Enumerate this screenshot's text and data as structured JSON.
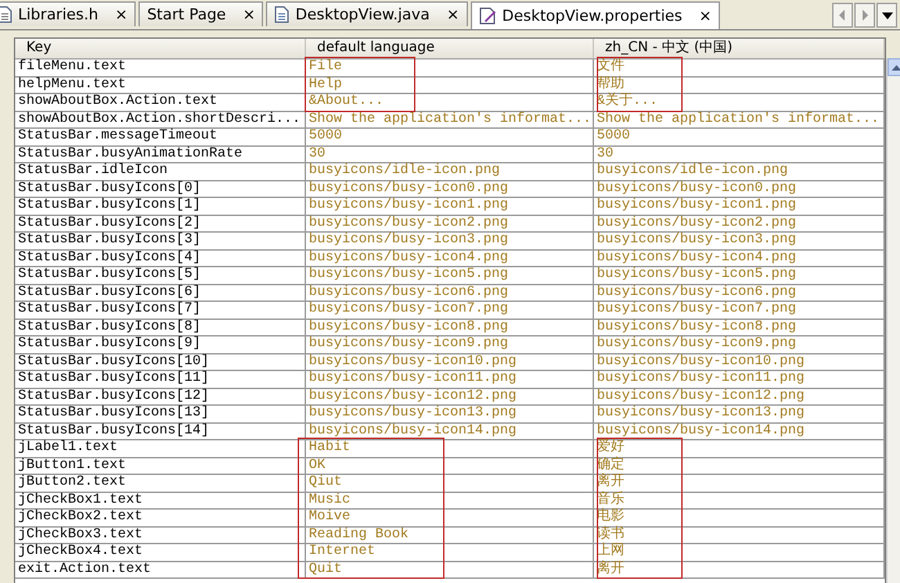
{
  "tabs": [
    {
      "label": "Libraries.h",
      "kind": "header",
      "close": "×",
      "selected": false
    },
    {
      "label": "Start Page",
      "kind": "none",
      "close": "×",
      "selected": false
    },
    {
      "label": "DesktopView.java",
      "kind": "java",
      "close": "×",
      "selected": false
    },
    {
      "label": "DesktopView.properties",
      "kind": "properties",
      "close": "×",
      "selected": true
    }
  ],
  "table": {
    "columns": [
      "Key",
      "default language",
      "zh_CN - 中文 (中国)"
    ],
    "rows": [
      {
        "key": "fileMenu.text",
        "default": "File",
        "zh": "文件",
        "marked": true
      },
      {
        "key": "helpMenu.text",
        "default": "Help",
        "zh": "帮助",
        "marked": true
      },
      {
        "key": "showAboutBox.Action.text",
        "default": "&About...",
        "zh": "&关于...",
        "marked": true
      },
      {
        "key": "showAboutBox.Action.shortDescri...",
        "default": "Show the application's informat...",
        "zh": "Show the application's informat...",
        "marked": false
      },
      {
        "key": "StatusBar.messageTimeout",
        "default": "5000",
        "zh": "5000",
        "marked": false
      },
      {
        "key": "StatusBar.busyAnimationRate",
        "default": "30",
        "zh": "30",
        "marked": false
      },
      {
        "key": "StatusBar.idleIcon",
        "default": "busyicons/idle-icon.png",
        "zh": "busyicons/idle-icon.png",
        "marked": false
      },
      {
        "key": "StatusBar.busyIcons[0]",
        "default": "busyicons/busy-icon0.png",
        "zh": "busyicons/busy-icon0.png",
        "marked": false
      },
      {
        "key": "StatusBar.busyIcons[1]",
        "default": "busyicons/busy-icon1.png",
        "zh": "busyicons/busy-icon1.png",
        "marked": false
      },
      {
        "key": "StatusBar.busyIcons[2]",
        "default": "busyicons/busy-icon2.png",
        "zh": "busyicons/busy-icon2.png",
        "marked": false
      },
      {
        "key": "StatusBar.busyIcons[3]",
        "default": "busyicons/busy-icon3.png",
        "zh": "busyicons/busy-icon3.png",
        "marked": false
      },
      {
        "key": "StatusBar.busyIcons[4]",
        "default": "busyicons/busy-icon4.png",
        "zh": "busyicons/busy-icon4.png",
        "marked": false
      },
      {
        "key": "StatusBar.busyIcons[5]",
        "default": "busyicons/busy-icon5.png",
        "zh": "busyicons/busy-icon5.png",
        "marked": false
      },
      {
        "key": "StatusBar.busyIcons[6]",
        "default": "busyicons/busy-icon6.png",
        "zh": "busyicons/busy-icon6.png",
        "marked": false
      },
      {
        "key": "StatusBar.busyIcons[7]",
        "default": "busyicons/busy-icon7.png",
        "zh": "busyicons/busy-icon7.png",
        "marked": false
      },
      {
        "key": "StatusBar.busyIcons[8]",
        "default": "busyicons/busy-icon8.png",
        "zh": "busyicons/busy-icon8.png",
        "marked": false
      },
      {
        "key": "StatusBar.busyIcons[9]",
        "default": "busyicons/busy-icon9.png",
        "zh": "busyicons/busy-icon9.png",
        "marked": false
      },
      {
        "key": "StatusBar.busyIcons[10]",
        "default": "busyicons/busy-icon10.png",
        "zh": "busyicons/busy-icon10.png",
        "marked": false
      },
      {
        "key": "StatusBar.busyIcons[11]",
        "default": "busyicons/busy-icon11.png",
        "zh": "busyicons/busy-icon11.png",
        "marked": false
      },
      {
        "key": "StatusBar.busyIcons[12]",
        "default": "busyicons/busy-icon12.png",
        "zh": "busyicons/busy-icon12.png",
        "marked": false
      },
      {
        "key": "StatusBar.busyIcons[13]",
        "default": "busyicons/busy-icon13.png",
        "zh": "busyicons/busy-icon13.png",
        "marked": false
      },
      {
        "key": "StatusBar.busyIcons[14]",
        "default": "busyicons/busy-icon14.png",
        "zh": "busyicons/busy-icon14.png",
        "marked": false
      },
      {
        "key": "jLabel1.text",
        "default": "Habit",
        "zh": "爱好",
        "marked": true
      },
      {
        "key": "jButton1.text",
        "default": "OK",
        "zh": "确定",
        "marked": true
      },
      {
        "key": "jButton2.text",
        "default": "Qiut",
        "zh": "离开",
        "marked": true
      },
      {
        "key": "jCheckBox1.text",
        "default": "Music",
        "zh": "音乐",
        "marked": true
      },
      {
        "key": "jCheckBox2.text",
        "default": "Moive",
        "zh": "电影",
        "marked": true
      },
      {
        "key": "jCheckBox3.text",
        "default": "Reading Book",
        "zh": "读书",
        "marked": true
      },
      {
        "key": "jCheckBox4.text",
        "default": "Internet",
        "zh": "上网",
        "marked": true
      },
      {
        "key": "exit.Action.text",
        "default": "Quit",
        "zh": "离开",
        "marked": true
      }
    ]
  }
}
